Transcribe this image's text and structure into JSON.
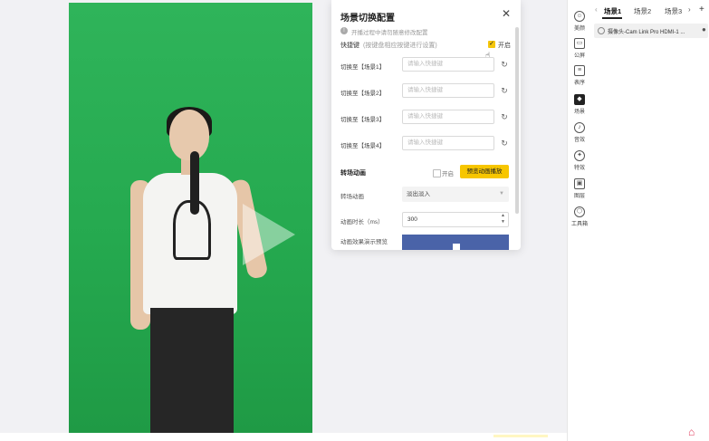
{
  "dialog": {
    "title": "场景切换配置",
    "close": "✕",
    "tip": "开播过程中请勿随意修改配置",
    "hotkey_label": "快捷键",
    "hotkey_hint": "(按键盘相应按键进行设置)",
    "hotkey_enabled_label": "开启",
    "hotkey_rows": [
      {
        "label": "切换至【场景1】",
        "placeholder": "请输入快捷键"
      },
      {
        "label": "切换至【场景2】",
        "placeholder": "请输入快捷键"
      },
      {
        "label": "切换至【场景3】",
        "placeholder": "请输入快捷键"
      },
      {
        "label": "切换至【场景4】",
        "placeholder": "请输入快捷键"
      }
    ],
    "anim_label": "转场动画",
    "anim_enabled_label": "开启",
    "anim_preview_button": "预览动画播放",
    "effect_label": "转场动画",
    "effect_value": "淡出淡入",
    "duration_label": "动画时长（ms）",
    "duration_value": "300",
    "demo_label": "动画效果演示预览"
  },
  "toolbar": [
    {
      "label": "美颜",
      "icon": "beauty-icon",
      "glyph": "☺"
    },
    {
      "label": "公屏",
      "icon": "chat-icon",
      "glyph": "▭"
    },
    {
      "label": "表序",
      "icon": "list-icon",
      "glyph": "≡"
    },
    {
      "label": "场景",
      "icon": "layers-icon",
      "glyph": "◆"
    },
    {
      "label": "音效",
      "icon": "sound-icon",
      "glyph": "♪"
    },
    {
      "label": "特效",
      "icon": "magic-icon",
      "glyph": "✦"
    },
    {
      "label": "图层",
      "icon": "image-icon",
      "glyph": "▣"
    },
    {
      "label": "工具箱",
      "icon": "toolbox-icon",
      "glyph": "⬡"
    }
  ],
  "scenes": {
    "tabs": [
      "场景1",
      "场景2",
      "场景3"
    ],
    "active_tab": 0,
    "source_item": "摄像头-Cam Link Pro HDMI-1 ..."
  },
  "colors": {
    "accent": "#f7c600",
    "greenscreen": "#29ad53"
  }
}
